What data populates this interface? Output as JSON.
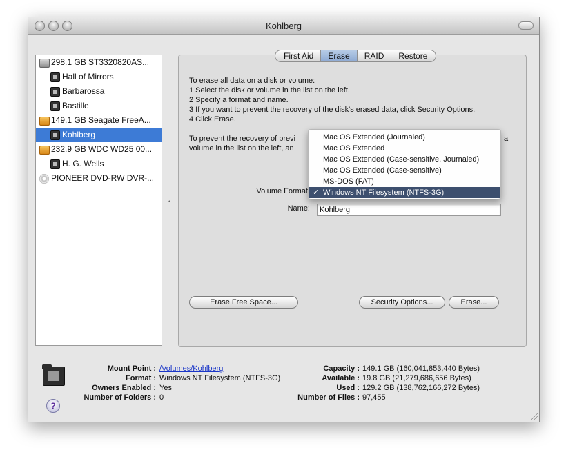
{
  "window": {
    "title": "Kohlberg"
  },
  "sidebar": {
    "items": [
      {
        "label": "298.1 GB ST3320820AS...",
        "icon": "hard-disk-icon",
        "level": 0
      },
      {
        "label": "Hall of Mirrors",
        "icon": "volume-icon",
        "level": 1
      },
      {
        "label": "Barbarossa",
        "icon": "volume-icon",
        "level": 1
      },
      {
        "label": "Bastille",
        "icon": "volume-icon",
        "level": 1
      },
      {
        "label": "149.1 GB Seagate FreeA...",
        "icon": "external-disk-icon",
        "level": 0
      },
      {
        "label": "Kohlberg",
        "icon": "volume-icon",
        "level": 1,
        "selected": true
      },
      {
        "label": "232.9 GB WDC WD25 00...",
        "icon": "external-disk-icon",
        "level": 0
      },
      {
        "label": "H. G. Wells",
        "icon": "volume-icon",
        "level": 1
      },
      {
        "label": "PIONEER DVD-RW DVR-...",
        "icon": "optical-drive-icon",
        "level": 0
      }
    ]
  },
  "tabs": [
    "First Aid",
    "Erase",
    "RAID",
    "Restore"
  ],
  "active_tab": "Erase",
  "instructions": {
    "line1": "To erase all data on a disk or volume:",
    "line2": "1 Select the disk or volume in the list on the left.",
    "line3": "2 Specify a format and name.",
    "line4": "3 If you want to prevent the recovery of the disk's erased data, click Security Options.",
    "line5": "4 Click Erase.",
    "prevent_line1": "To prevent the recovery of previ",
    "prevent_line1_tail": "a",
    "prevent_line2": "volume in the list on the left, an"
  },
  "form": {
    "volume_format_label": "Volume Format",
    "name_label": "Name:",
    "name_value": "Kohlberg"
  },
  "format_menu": {
    "check_mark": "✓",
    "options": [
      "Mac OS Extended (Journaled)",
      "Mac OS Extended",
      "Mac OS Extended (Case-sensitive, Journaled)",
      "Mac OS Extended (Case-sensitive)",
      "MS-DOS (FAT)",
      "Windows NT Filesystem (NTFS-3G)"
    ],
    "selected": "Windows NT Filesystem (NTFS-3G)"
  },
  "buttons": {
    "erase_free_space": "Erase Free Space...",
    "security_options": "Security Options...",
    "erase": "Erase..."
  },
  "info": {
    "mount_point_label": "Mount Point :",
    "mount_point_value": "/Volumes/Kohlberg",
    "format_label": "Format :",
    "format_value": "Windows NT Filesystem (NTFS-3G)",
    "owners_label": "Owners Enabled :",
    "owners_value": "Yes",
    "folders_label": "Number of Folders :",
    "folders_value": "0",
    "capacity_label": "Capacity :",
    "capacity_value": "149.1 GB (160,041,853,440 Bytes)",
    "available_label": "Available :",
    "available_value": "19.8 GB (21,279,686,656 Bytes)",
    "used_label": "Used :",
    "used_value": "129.2 GB (138,762,166,272 Bytes)",
    "files_label": "Number of Files :",
    "files_value": "97,455"
  },
  "help_glyph": "?"
}
